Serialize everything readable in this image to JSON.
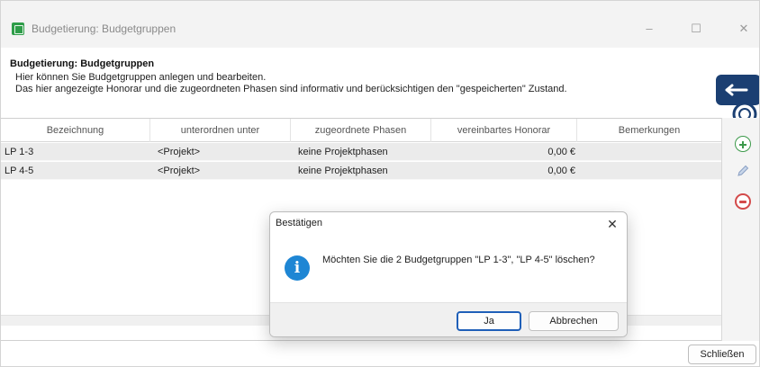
{
  "window": {
    "title": "Budgetierung: Budgetgruppen",
    "controls": {
      "minimize": "–",
      "maximize": "☐",
      "close": "✕"
    }
  },
  "header": {
    "title": "Budgetierung: Budgetgruppen",
    "description_line1": "Hier können Sie Budgetgruppen anlegen und bearbeiten.",
    "description_line2": "Das hier angezeigte Honorar und die zugeordneten Phasen sind informativ und berücksichtigen den \"gespeicherten\" Zustand."
  },
  "table": {
    "columns": [
      "Bezeichnung",
      "unterordnen unter",
      "zugeordnete Phasen",
      "vereinbartes Honorar",
      "Bemerkungen"
    ],
    "rows": [
      {
        "bezeichnung": "LP 1-3",
        "unterordnen": "<Projekt>",
        "phasen": "keine Projektphasen",
        "honorar": "0,00 €",
        "bemerkungen": ""
      },
      {
        "bezeichnung": "LP 4-5",
        "unterordnen": "<Projekt>",
        "phasen": "keine Projektphasen",
        "honorar": "0,00 €",
        "bemerkungen": ""
      }
    ]
  },
  "toolbar": {
    "icons": [
      "add-icon",
      "edit-pencil-icon",
      "delete-icon"
    ]
  },
  "footer": {
    "close_label": "Schließen"
  },
  "dialog": {
    "title": "Bestätigen",
    "close_glyph": "✕",
    "message": "Möchten Sie die 2 Budgetgruppen \"LP 1-3\", \"LP 4-5\" löschen?",
    "yes_label": "Ja",
    "cancel_label": "Abbrechen"
  },
  "colors": {
    "accent_green": "#2e9d49",
    "info_blue": "#1e86d4",
    "delete_red": "#d34a4a",
    "primary_border": "#1f5fb8"
  }
}
